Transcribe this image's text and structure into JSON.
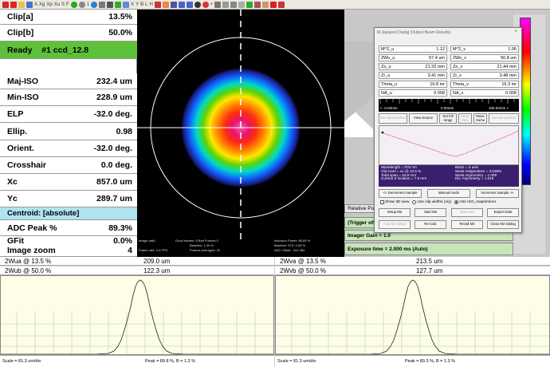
{
  "toolbar": {
    "items": [
      "X·Xg",
      "Xp",
      "Xu",
      "S",
      "F",
      "1",
      "X",
      "Y",
      "B",
      "L",
      "H",
      "+",
      "-"
    ]
  },
  "left_panel": {
    "rows": [
      {
        "label": "Clip[a]",
        "value": "13.5%"
      },
      {
        "label": "Clip[b]",
        "value": "50.0%"
      },
      {
        "label": "Ready    #1 ccd_12.8",
        "value": ""
      },
      {
        "label": "Maj-ISO",
        "value": "232.4 um"
      },
      {
        "label": "Min-ISO",
        "value": "228.9 um"
      },
      {
        "label": "ELP",
        "value": "-32.0 deg."
      },
      {
        "label": "Ellip.",
        "value": "0.98"
      },
      {
        "label": "Orient.",
        "value": "-32.0 deg."
      },
      {
        "label": "Crosshair",
        "value": "0.0 deg."
      },
      {
        "label": "Xc",
        "value": "857.0 um"
      },
      {
        "label": "Yc",
        "value": "289.7 um"
      },
      {
        "label": "Centroid: [absolute]",
        "value": ""
      },
      {
        "label": "ADC Peak %",
        "value": "89.3%"
      },
      {
        "label": "GFit",
        "value": "0.0%"
      },
      {
        "label": "Image zoom",
        "value": "4"
      }
    ]
  },
  "beam": {
    "line1": "Image valid",
    "line2": "Good frames: 8 Bad Frames 0",
    "line3": "Baseline: 1.29 %",
    "line4": "Frame rate: 4.3 FPS",
    "line5": "Frames averaged: 20",
    "line6": "Inclusion Power: 86.89 %",
    "line7": "Baseline STD: 0.08 %",
    "line8": "ADC Offset: -104 0Bx"
  },
  "dialog": {
    "title": "M-Squared Dialog  (Output Beam Results)",
    "close": "×",
    "left_params": [
      {
        "label": "M^2_u",
        "value": "1.12"
      },
      {
        "label": "2Wo_u",
        "value": "57.4 um"
      },
      {
        "label": "Zo_u",
        "value": "21.32 mm"
      },
      {
        "label": "Zr_u",
        "value": "3.41 mm"
      },
      {
        "label": "Theta_u",
        "value": "16.8 mr"
      },
      {
        "label": "NA_u",
        "value": "0.008"
      }
    ],
    "right_params": [
      {
        "label": "M^2_v",
        "value": "1.06"
      },
      {
        "label": "2Wo_v",
        "value": "56.8 um"
      },
      {
        "label": "Zo_v",
        "value": "21.44 mm"
      },
      {
        "label": "Zr_v",
        "value": "3.48 mm"
      },
      {
        "label": "Theta_v",
        "value": "16.3 mr"
      },
      {
        "label": "NA_v",
        "value": "0.008"
      }
    ],
    "ruler_left": "< -0.00mm",
    "ruler_mid": "0.00mm",
    "ruler_right": "100.00mm >",
    "buttons_row1": [
      "Set start position",
      "View Source",
      "Set full range",
      "Move Zero",
      "Move Home",
      "Set end position"
    ],
    "info_left": [
      "Wavelength = 675 nm",
      "Clip level    = uv @ 13.5 %",
      "Total span   = 34.9 mm",
      "Current Z location = 7.9 mm"
    ],
    "info_right": [
      "Black = X axis",
      "Waist Astigmatism = 3.538%",
      "Waist Asymmetry   = 1.008",
      "Div. Asymmetry     = 1.019"
    ],
    "buttons_row2": [
      "<< Decrement Sample",
      "Manual mode",
      "Increment Sample >>"
    ],
    "radio_show3d": "Show 3D view",
    "radio_clip": "Use clip widths (u/y)",
    "radio_iso": "Use ISO_maps/minor",
    "buttons_row3": [
      "Setup M2",
      "Start M2",
      "Save M2",
      "Export Data"
    ],
    "buttons_row4": [
      "Auto M2 Setup",
      "Re-Calc",
      "Recall M2",
      "Close M2 Dialog"
    ]
  },
  "right_panel": {
    "relative_label": "Relative Pos",
    "trigger": "(Trigger off",
    "gain": "Imager Gain = 1.0",
    "exposure": "Exposure time = 2.000 ms (Auto)"
  },
  "profiles": {
    "u": {
      "w135_label": "2Wua @ 13.5 %",
      "w135_value": "209.0 um",
      "w50_label": "2Wub @ 50.0 %",
      "w50_value": "122.3 um",
      "scale": "Scale = 81.3 um/div",
      "peak": "Peak = 89.8 %,  B = 1.3 %"
    },
    "v": {
      "w135_label": "2Wva @ 13.5 %",
      "w135_value": "213.5 um",
      "w50_label": "2Wvb @ 50.0 %",
      "w50_value": "127.7 um",
      "scale": "Scale = 81.3 um/div",
      "peak": "Peak = 89.3 %,  B = 1.3 %"
    }
  },
  "colors": {
    "ready_green": "#5ec13a",
    "centroid_cyan": "#aee3ef",
    "panel_purple": "#3a1f6e",
    "plot_bg": "#fdfde8"
  }
}
